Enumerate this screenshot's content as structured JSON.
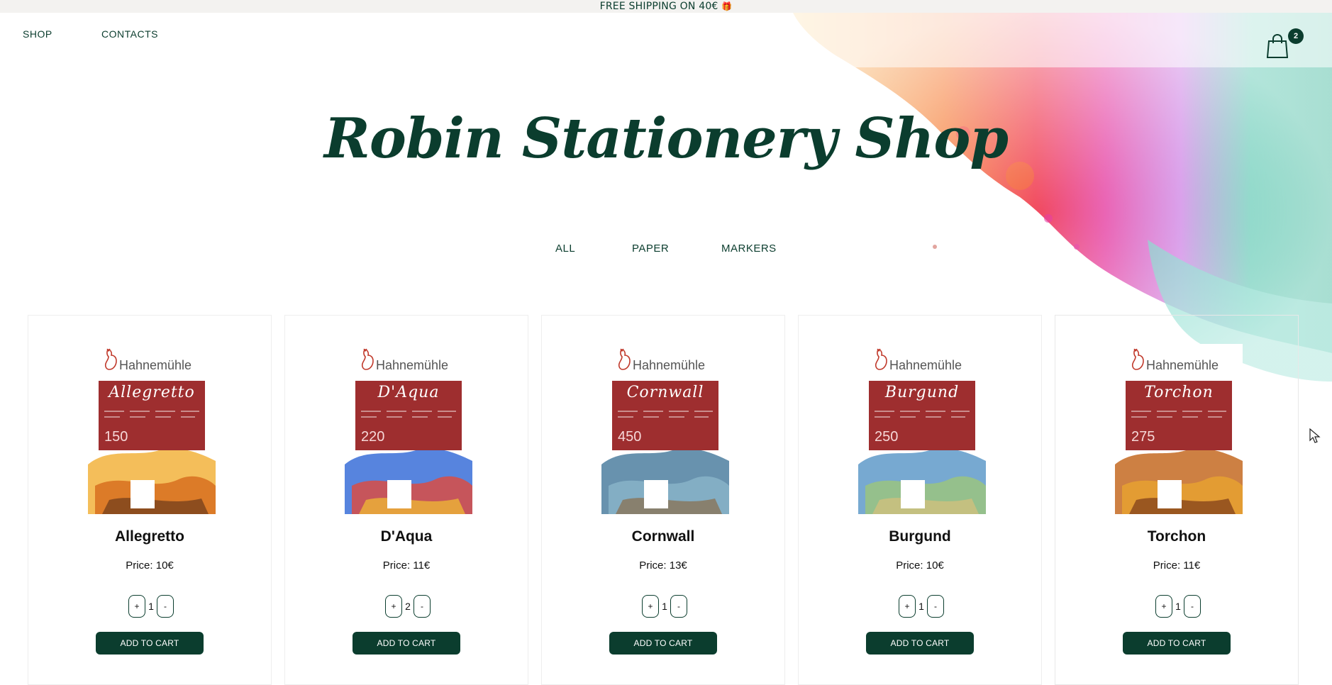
{
  "announcement": "FREE SHIPPING ON 40€",
  "nav": {
    "shop": "SHOP",
    "contacts": "CONTACTS"
  },
  "cart": {
    "count": "2",
    "icon": "shopping-bag-icon"
  },
  "site_title": "Robin Stationery Shop",
  "filters": [
    "ALL",
    "PAPER",
    "MARKERS"
  ],
  "brand_name": "Hahnemühle",
  "colors": {
    "primary": "#0b3d2e",
    "cover_red": "#9e2e2f",
    "topbar_bg": "#f3f2f0"
  },
  "add_to_cart_label": "ADD TO CART",
  "products": [
    {
      "name": "Allegretto",
      "price": "Price: 10€",
      "qty": "1",
      "cover_weight": "150"
    },
    {
      "name": "D'Aqua",
      "price": "Price: 11€",
      "qty": "2",
      "cover_weight": "220"
    },
    {
      "name": "Cornwall",
      "price": "Price: 13€",
      "qty": "1",
      "cover_weight": "450"
    },
    {
      "name": "Burgund",
      "price": "Price: 10€",
      "qty": "1",
      "cover_weight": "250"
    },
    {
      "name": "Torchon",
      "price": "Price: 11€",
      "qty": "1",
      "cover_weight": "275"
    }
  ]
}
